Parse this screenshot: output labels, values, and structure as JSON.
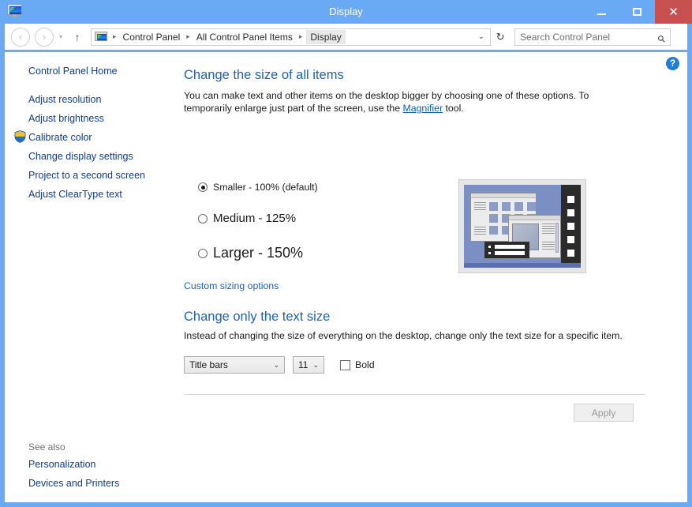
{
  "window": {
    "title": "Display",
    "app_icon": "display-monitor-icon",
    "controls": {
      "minimize": "minimize-button",
      "maximize": "maximize-button",
      "close": "close-button",
      "close_glyph": "✕"
    },
    "accent_color": "#6aa9f4",
    "close_color": "#c75050"
  },
  "toolbar": {
    "back": "‹",
    "forward": "›",
    "history_caret": "▾",
    "up": "↑",
    "breadcrumbs": [
      {
        "label": "Control Panel",
        "current": false
      },
      {
        "label": "All Control Panel Items",
        "current": false
      },
      {
        "label": "Display",
        "current": true
      }
    ],
    "separator": "▸",
    "address_caret": "⌄",
    "refresh": "↻",
    "search": {
      "placeholder": "Search Control Panel",
      "icon": "search-icon"
    }
  },
  "help": {
    "label": "?"
  },
  "sidebar": {
    "home": "Control Panel Home",
    "items": [
      {
        "label": "Adjust resolution",
        "shield": false
      },
      {
        "label": "Adjust brightness",
        "shield": false
      },
      {
        "label": "Calibrate color",
        "shield": true
      },
      {
        "label": "Change display settings",
        "shield": false
      },
      {
        "label": "Project to a second screen",
        "shield": false
      },
      {
        "label": "Adjust ClearType text",
        "shield": false
      }
    ],
    "see_also_label": "See also",
    "see_also": [
      {
        "label": "Personalization"
      },
      {
        "label": "Devices and Printers"
      }
    ]
  },
  "main": {
    "heading1": "Change the size of all items",
    "description1_part1": "You can make text and other items on the desktop bigger by choosing one of these options. To temporarily enlarge just part of the screen, use the ",
    "description1_link": "Magnifier",
    "description1_part2": " tool.",
    "scale_options": [
      {
        "label": "Smaller - 100% (default)",
        "selected": true,
        "font_size": "12.3px"
      },
      {
        "label": "Medium - 125%",
        "selected": false,
        "font_size": "15px"
      },
      {
        "label": "Larger - 150%",
        "selected": false,
        "font_size": "18px"
      }
    ],
    "custom_sizing_link": "Custom sizing options",
    "heading2": "Change only the text size",
    "description2": "Instead of changing the size of everything on the desktop, change only the text size for a specific item.",
    "item_select": {
      "value": "Title bars",
      "caret": "⌄"
    },
    "size_select": {
      "value": "11",
      "caret": "⌄"
    },
    "bold_checkbox": {
      "label": "Bold",
      "checked": false
    },
    "apply_button": {
      "label": "Apply",
      "enabled": false
    }
  }
}
